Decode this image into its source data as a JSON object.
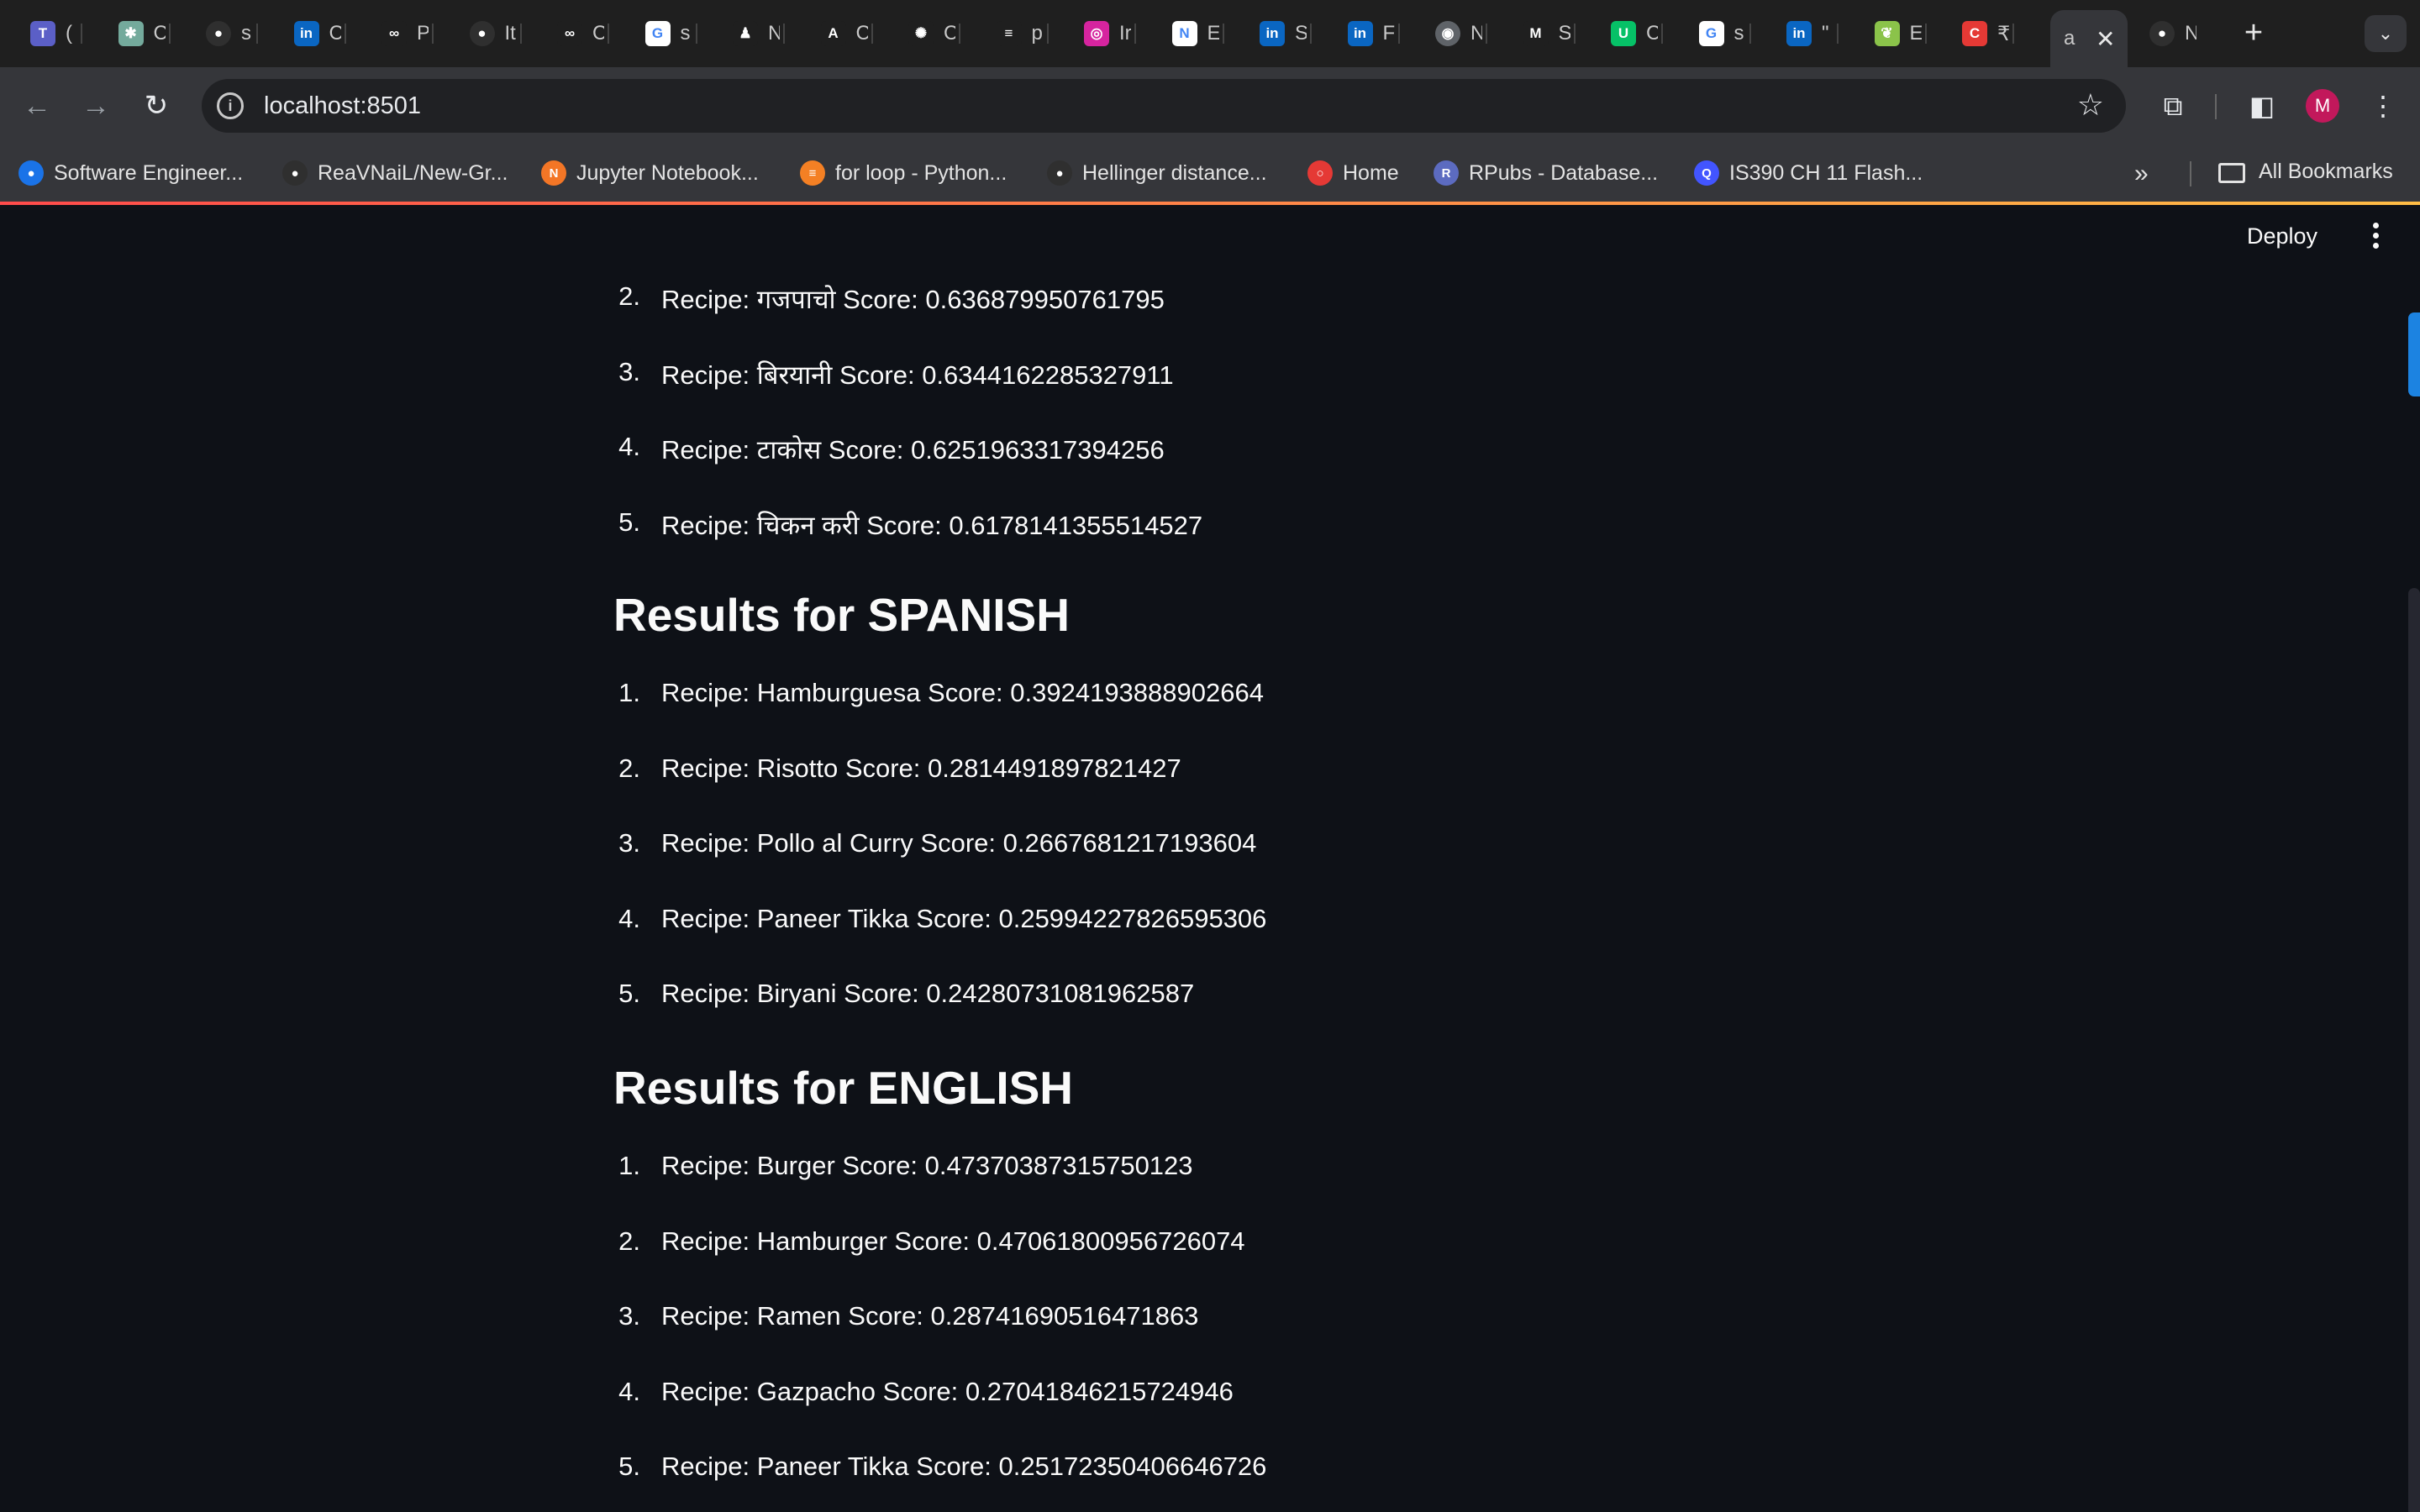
{
  "browser": {
    "tabs": [
      {
        "icon": "teams-icon",
        "title": "(",
        "color": "#5b5fc7",
        "glyph": "T"
      },
      {
        "icon": "chatgpt-icon",
        "title": "C",
        "color": "#74aa9c",
        "glyph": "✱"
      },
      {
        "icon": "github-icon",
        "title": "s",
        "color": "#2f2f2f",
        "glyph": "●"
      },
      {
        "icon": "linkedin-icon",
        "title": "C",
        "color": "#0a66c2",
        "glyph": "in"
      },
      {
        "icon": "infinity-icon",
        "title": "P",
        "color": "#1f1f1f",
        "glyph": "∞"
      },
      {
        "icon": "github-icon",
        "title": "It",
        "color": "#2f2f2f",
        "glyph": "●"
      },
      {
        "icon": "infinity-icon",
        "title": "C",
        "color": "#1f1f1f",
        "glyph": "∞"
      },
      {
        "icon": "google-icon",
        "title": "s",
        "color": "#ffffff",
        "glyph": "G"
      },
      {
        "icon": "robot-icon",
        "title": "N",
        "color": "#1f1f1f",
        "glyph": "♟"
      },
      {
        "icon": "a-logo-icon",
        "title": "C",
        "color": "#1f1f1f",
        "glyph": "A"
      },
      {
        "icon": "openai-icon",
        "title": "C",
        "color": "#1f1f1f",
        "glyph": "✺"
      },
      {
        "icon": "stackoverflow-icon",
        "title": "p",
        "color": "#1f1f1f",
        "glyph": "≡"
      },
      {
        "icon": "instagram-icon",
        "title": "Ir",
        "color": "#d6249f",
        "glyph": "◎"
      },
      {
        "icon": "notion-icon",
        "title": "E",
        "color": "#ffffff",
        "glyph": "N"
      },
      {
        "icon": "linkedin-icon",
        "title": "S",
        "color": "#0a66c2",
        "glyph": "in"
      },
      {
        "icon": "linkedin-icon",
        "title": "F",
        "color": "#0a66c2",
        "glyph": "in"
      },
      {
        "icon": "chrome-icon",
        "title": "N",
        "color": "#5f6368",
        "glyph": "◉"
      },
      {
        "icon": "gmail-icon",
        "title": "S",
        "color": "#1f1f1f",
        "glyph": "M"
      },
      {
        "icon": "ubereats-icon",
        "title": "C",
        "color": "#06c167",
        "glyph": "U"
      },
      {
        "icon": "google-icon",
        "title": "s",
        "color": "#ffffff",
        "glyph": "G"
      },
      {
        "icon": "linkedin-icon",
        "title": "\"",
        "color": "#0a66c2",
        "glyph": "in"
      },
      {
        "icon": "leaf-icon",
        "title": "E",
        "color": "#8bc34a",
        "glyph": "❦"
      },
      {
        "icon": "c-logo-icon",
        "title": "₹",
        "color": "#e53935",
        "glyph": "C"
      }
    ],
    "active_tab": {
      "title": "a",
      "close": "✕"
    },
    "last_tab": {
      "icon": "github-icon",
      "title": "N",
      "color": "#2f2f2f",
      "glyph": "●"
    },
    "new_tab": "+",
    "tab_menu": "⌄",
    "url": "localhost:8501",
    "avatar_letter": "M",
    "bookmarks": [
      {
        "icon": "bookmark-favicon",
        "label": "Software Engineer...",
        "color": "#1a73e8",
        "glyph": "●"
      },
      {
        "icon": "github-icon",
        "label": "ReaVNaiL/New-Gr...",
        "color": "#2f2f2f",
        "glyph": "●"
      },
      {
        "icon": "jupyter-icon",
        "label": "Jupyter Notebook...",
        "color": "#f37626",
        "glyph": "N"
      },
      {
        "icon": "stackoverflow-icon",
        "label": "for loop - Python...",
        "color": "#f48024",
        "glyph": "≡"
      },
      {
        "icon": "github-icon",
        "label": "Hellinger distance...",
        "color": "#2f2f2f",
        "glyph": "●"
      },
      {
        "icon": "home-icon",
        "label": "Home",
        "color": "#e53935",
        "glyph": "○"
      },
      {
        "icon": "rpubs-icon",
        "label": "RPubs - Database...",
        "color": "#5c6bc0",
        "glyph": "R"
      },
      {
        "icon": "quizlet-icon",
        "label": "IS390 CH 11 Flash...",
        "color": "#4255ff",
        "glyph": "Q"
      }
    ],
    "more_bookmarks": "»",
    "all_bookmarks": "All Bookmarks"
  },
  "app": {
    "deploy_label": "Deploy",
    "first_list": [
      {
        "num": "2.",
        "text": "Recipe: गजपाचो Score: 0.636879950761795"
      },
      {
        "num": "3.",
        "text": "Recipe: बिरयानी Score: 0.6344162285327911"
      },
      {
        "num": "4.",
        "text": "Recipe: टाकोस Score: 0.6251963317394256"
      },
      {
        "num": "5.",
        "text": "Recipe: चिकन करी Score: 0.6178141355514527"
      }
    ],
    "sections": [
      {
        "heading": "Results for SPANISH",
        "items": [
          {
            "num": "1.",
            "text": "Recipe: Hamburguesa Score: 0.3924193888902664"
          },
          {
            "num": "2.",
            "text": "Recipe: Risotto Score: 0.2814491897821427"
          },
          {
            "num": "3.",
            "text": "Recipe: Pollo al Curry Score: 0.2667681217193604"
          },
          {
            "num": "4.",
            "text": "Recipe: Paneer Tikka Score: 0.25994227826595306"
          },
          {
            "num": "5.",
            "text": "Recipe: Biryani Score: 0.24280731081962587"
          }
        ]
      },
      {
        "heading": "Results for ENGLISH",
        "items": [
          {
            "num": "1.",
            "text": "Recipe: Burger Score: 0.47370387315750123"
          },
          {
            "num": "2.",
            "text": "Recipe: Hamburger Score: 0.47061800956726074"
          },
          {
            "num": "3.",
            "text": "Recipe: Ramen Score: 0.28741690516471863"
          },
          {
            "num": "4.",
            "text": "Recipe: Gazpacho Score: 0.27041846215724946"
          },
          {
            "num": "5.",
            "text": "Recipe: Paneer Tikka Score: 0.25172350406646726"
          }
        ]
      }
    ]
  }
}
